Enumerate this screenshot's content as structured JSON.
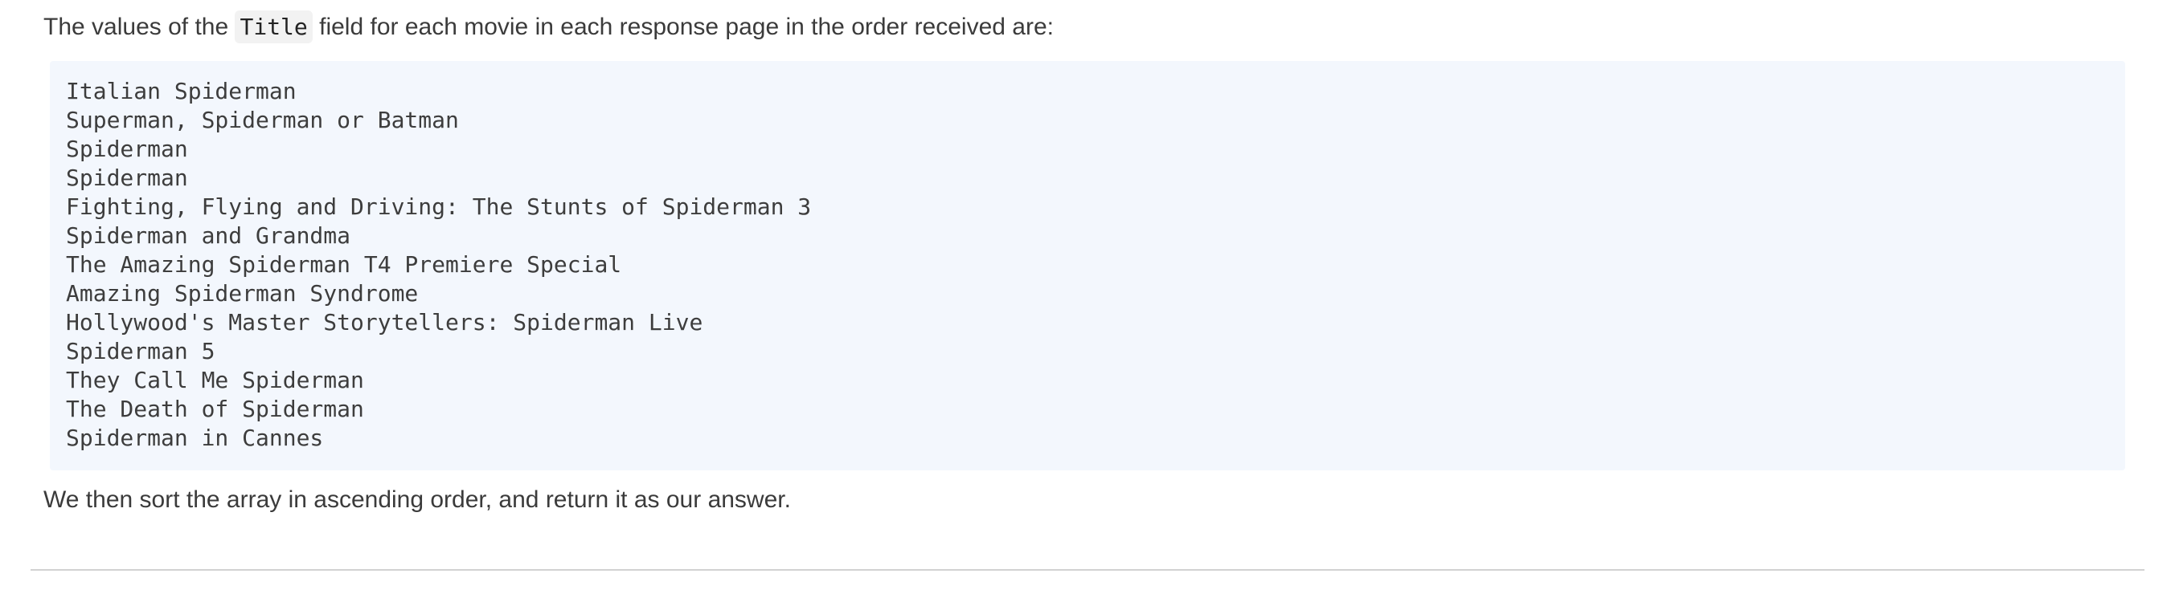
{
  "intro": {
    "before": "The values of the ",
    "code": "Title",
    "after": " field for each movie in each response page in the order received are:"
  },
  "code_lines": [
    "Italian Spiderman",
    "Superman, Spiderman or Batman",
    "Spiderman",
    "Spiderman",
    "Fighting, Flying and Driving: The Stunts of Spiderman 3",
    "Spiderman and Grandma",
    "The Amazing Spiderman T4 Premiere Special",
    "Amazing Spiderman Syndrome",
    "Hollywood's Master Storytellers: Spiderman Live",
    "Spiderman 5",
    "They Call Me Spiderman",
    "The Death of Spiderman",
    "Spiderman in Cannes"
  ],
  "outro": "We then sort the array in ascending order, and return it as our answer."
}
